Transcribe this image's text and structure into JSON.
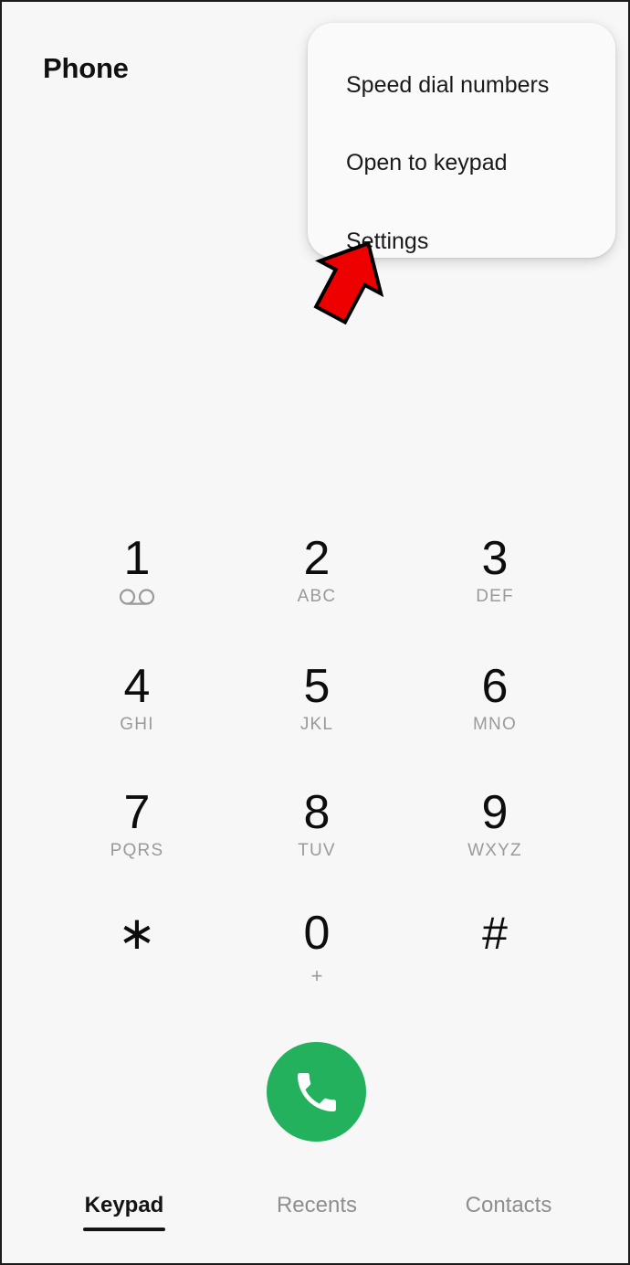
{
  "window": {
    "background_color": "#f7f7f7",
    "border_color": "#1c1c1c"
  },
  "header": {
    "title": "Phone"
  },
  "overflow_menu": {
    "visible": true,
    "background_color": "#fafafa",
    "items": [
      {
        "label": "Speed dial numbers",
        "name": "menu-item-speed-dial"
      },
      {
        "label": "Open to keypad",
        "name": "menu-item-open-keypad"
      },
      {
        "label": "Settings",
        "name": "menu-item-settings"
      }
    ]
  },
  "annotation": {
    "type": "arrow",
    "icon": "up-arrow-icon",
    "color": "#ee0000",
    "outline_color": "#000000",
    "points_at": "Settings"
  },
  "keypad": {
    "keys": [
      {
        "digit": "1",
        "sub": "",
        "icon": "voicemail-icon"
      },
      {
        "digit": "2",
        "sub": "ABC",
        "icon": ""
      },
      {
        "digit": "3",
        "sub": "DEF",
        "icon": ""
      },
      {
        "digit": "4",
        "sub": "GHI",
        "icon": ""
      },
      {
        "digit": "5",
        "sub": "JKL",
        "icon": ""
      },
      {
        "digit": "6",
        "sub": "MNO",
        "icon": ""
      },
      {
        "digit": "7",
        "sub": "PQRS",
        "icon": ""
      },
      {
        "digit": "8",
        "sub": "TUV",
        "icon": ""
      },
      {
        "digit": "9",
        "sub": "WXYZ",
        "icon": ""
      },
      {
        "digit": "∗",
        "sub": "",
        "icon": ""
      },
      {
        "digit": "0",
        "sub": "+",
        "icon": ""
      },
      {
        "digit": "#",
        "sub": "",
        "icon": ""
      }
    ]
  },
  "call_button": {
    "icon": "phone-handset-icon",
    "color": "#23b15d"
  },
  "tab_bar": {
    "tabs": [
      {
        "label": "Keypad",
        "selected": true
      },
      {
        "label": "Recents",
        "selected": false
      },
      {
        "label": "Contacts",
        "selected": false
      }
    ]
  }
}
